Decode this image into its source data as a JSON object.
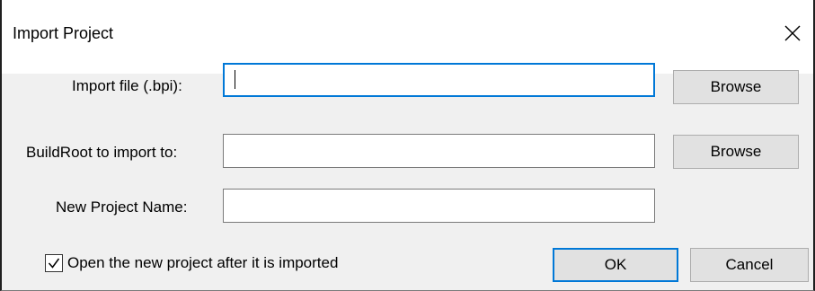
{
  "window": {
    "title": "Import Project",
    "close_icon": "close-icon"
  },
  "form": {
    "import_file_label": "Import file (.bpi):",
    "import_file_value": "",
    "buildroot_label": "BuildRoot to import to:",
    "buildroot_value": "",
    "project_name_label": "New Project Name:",
    "project_name_value": ""
  },
  "buttons": {
    "browse_import_label": "Browse",
    "browse_buildroot_label": "Browse",
    "ok_label": "OK",
    "cancel_label": "Cancel"
  },
  "options": {
    "open_after_import_label": "Open the new project after it is imported",
    "open_after_import_checked": true
  },
  "colors": {
    "focus_accent": "#0078d7",
    "button_face": "#e1e1e1",
    "dialog_background": "#f0f0f0"
  }
}
